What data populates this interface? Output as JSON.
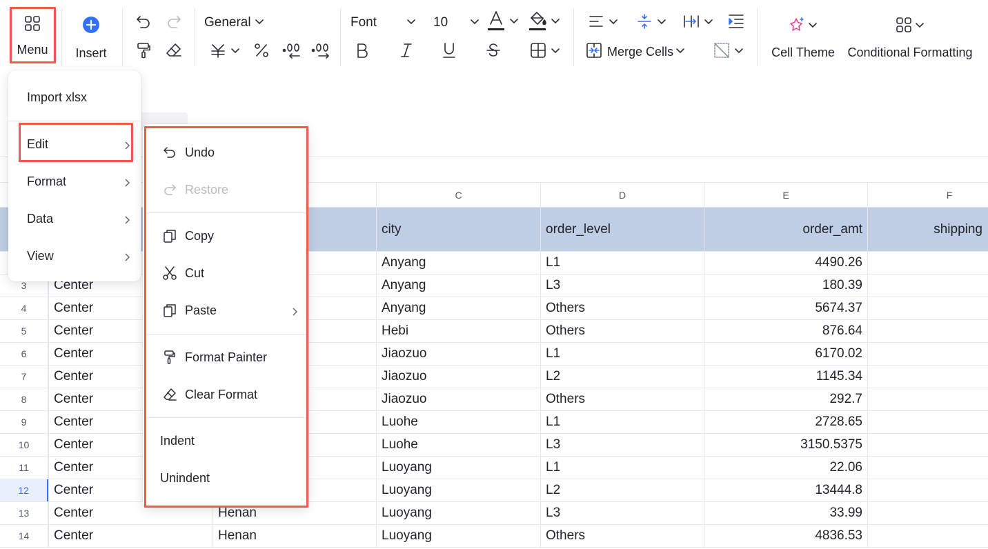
{
  "toolbar": {
    "menu_label": "Menu",
    "insert_label": "Insert",
    "number_format": "General",
    "font_name": "Font",
    "font_size": "10",
    "merge_cells_label": "Merge Cells",
    "cell_theme_label": "Cell Theme",
    "conditional_formatting_label": "Conditional Formatting",
    "font_color": "#1f2329",
    "fill_color": "#1f2329"
  },
  "main_menu": {
    "items": [
      {
        "label": "Import xlsx"
      },
      {
        "label": "Edit"
      },
      {
        "label": "Format"
      },
      {
        "label": "Data"
      },
      {
        "label": "View"
      }
    ]
  },
  "edit_menu": {
    "items": [
      {
        "label": "Undo",
        "icon": "undo-icon"
      },
      {
        "label": "Restore",
        "icon": "redo-icon",
        "disabled": true
      },
      {
        "label": "Copy",
        "icon": "copy-icon"
      },
      {
        "label": "Cut",
        "icon": "scissors-icon"
      },
      {
        "label": "Paste",
        "icon": "paste-icon"
      },
      {
        "label": "Format Painter",
        "icon": "format-painter-icon"
      },
      {
        "label": "Clear Format",
        "icon": "eraser-icon"
      },
      {
        "label": "Indent"
      },
      {
        "label": "Unindent"
      }
    ]
  },
  "grid": {
    "columns": [
      "C",
      "D",
      "E",
      "F"
    ],
    "header_row": {
      "c": "city",
      "d": "order_level",
      "e": "order_amt",
      "f": "shipping"
    },
    "selected_row": "12",
    "rows": [
      {
        "n": "",
        "a": "",
        "b": "",
        "c": "Anyang",
        "d": "L1",
        "e": "4490.26"
      },
      {
        "n": "3",
        "a": "Center",
        "b": "",
        "c": "Anyang",
        "d": "L3",
        "e": "180.39"
      },
      {
        "n": "4",
        "a": "Center",
        "b": "",
        "c": "Anyang",
        "d": "Others",
        "e": "5674.37"
      },
      {
        "n": "5",
        "a": "Center",
        "b": "",
        "c": "Hebi",
        "d": "Others",
        "e": "876.64"
      },
      {
        "n": "6",
        "a": "Center",
        "b": "",
        "c": "Jiaozuo",
        "d": "L1",
        "e": "6170.02"
      },
      {
        "n": "7",
        "a": "Center",
        "b": "",
        "c": "Jiaozuo",
        "d": "L2",
        "e": "1145.34"
      },
      {
        "n": "8",
        "a": "Center",
        "b": "",
        "c": "Jiaozuo",
        "d": "Others",
        "e": "292.7"
      },
      {
        "n": "9",
        "a": "Center",
        "b": "",
        "c": "Luohe",
        "d": "L1",
        "e": "2728.65"
      },
      {
        "n": "10",
        "a": "Center",
        "b": "",
        "c": "Luohe",
        "d": "L3",
        "e": "3150.5375"
      },
      {
        "n": "11",
        "a": "Center",
        "b": "",
        "c": "Luoyang",
        "d": "L1",
        "e": "22.06"
      },
      {
        "n": "12",
        "a": "Center",
        "b": "",
        "c": "Luoyang",
        "d": "L2",
        "e": "13444.8"
      },
      {
        "n": "13",
        "a": "Center",
        "b": "Henan",
        "c": "Luoyang",
        "d": "L3",
        "e": "33.99"
      },
      {
        "n": "14",
        "a": "Center",
        "b": "Henan",
        "c": "Luoyang",
        "d": "Others",
        "e": "4836.53"
      }
    ]
  }
}
